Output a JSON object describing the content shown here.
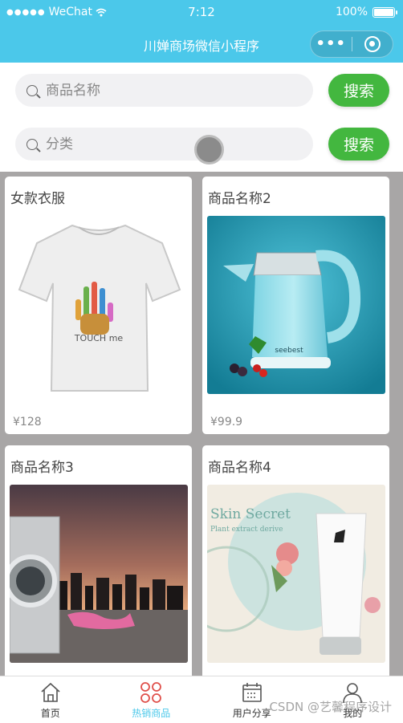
{
  "status_bar": {
    "carrier": "WeChat",
    "time": "7:12",
    "battery": "100%"
  },
  "nav": {
    "title": "川婵商场微信小程序",
    "more_label": "•••"
  },
  "search": [
    {
      "placeholder": "商品名称",
      "button": "搜索"
    },
    {
      "placeholder": "分类",
      "button": "搜索"
    }
  ],
  "products": [
    {
      "name": "女款衣服",
      "price": "¥128"
    },
    {
      "name": "商品名称2",
      "price": "¥99.9"
    },
    {
      "name": "商品名称3",
      "price": ""
    },
    {
      "name": "商品名称4",
      "price": ""
    }
  ],
  "product_image_text": {
    "tshirt": "TOUCH me",
    "skin_title": "Skin Secret",
    "skin_subtitle": "Plant extract derive",
    "kettle_brand": "seebest"
  },
  "tabs": [
    {
      "label": "首页",
      "icon": "home-icon"
    },
    {
      "label": "热销商品",
      "icon": "hot-goods-icon",
      "active": true
    },
    {
      "label": "用户分享",
      "icon": "share-calendar-icon"
    },
    {
      "label": "我的",
      "icon": "user-icon"
    }
  ],
  "watermark": "CSDN @艺馨程序设计",
  "colors": {
    "accent": "#4bc8ea",
    "button_green": "#43b73f",
    "grid_bg": "#a8a6a6"
  }
}
